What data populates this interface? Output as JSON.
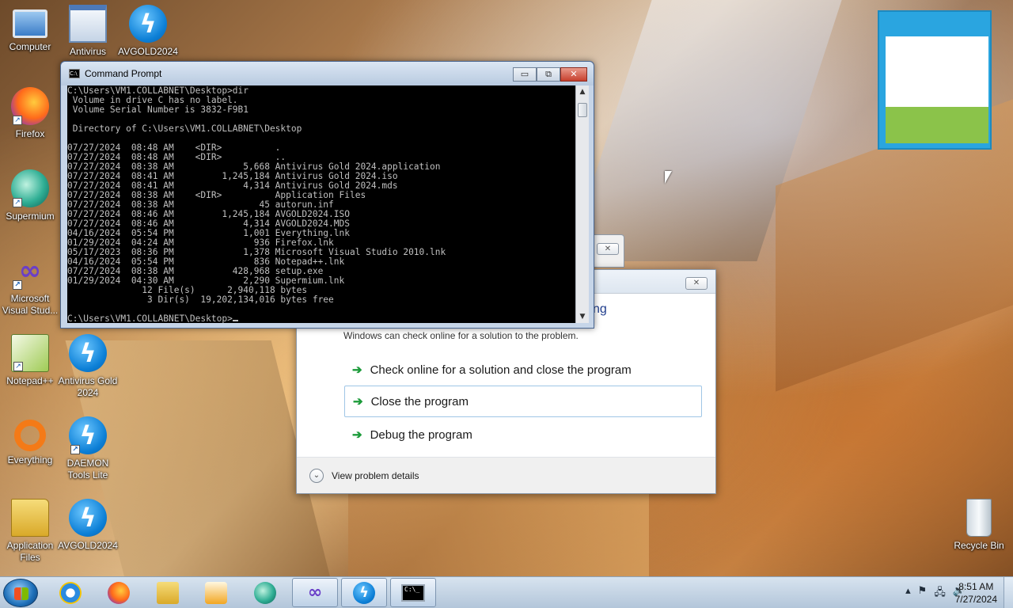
{
  "desktop": {
    "icons": [
      {
        "label": "Computer",
        "icon": "computer-icon"
      },
      {
        "label": "Antivirus",
        "icon": "antivirus-icon"
      },
      {
        "label": "AVGOLD2024",
        "icon": "daemon-bolt-icon"
      },
      {
        "label": "Firefox",
        "icon": "firefox-icon"
      },
      {
        "label": "Supermium",
        "icon": "supermium-icon"
      },
      {
        "label": "Microsoft Visual Stud...",
        "icon": "visual-studio-icon"
      },
      {
        "label": "Notepad++",
        "icon": "notepadpp-icon"
      },
      {
        "label": "Antivirus Gold 2024",
        "icon": "daemon-bolt-icon"
      },
      {
        "label": "Everything",
        "icon": "everything-icon"
      },
      {
        "label": "DAEMON Tools Lite",
        "icon": "daemon-bolt-icon"
      },
      {
        "label": "Application Files",
        "icon": "folder-icon"
      },
      {
        "label": "AVGOLD2024",
        "icon": "daemon-bolt-icon"
      },
      {
        "label": "Recycle Bin",
        "icon": "recycle-bin-icon"
      }
    ]
  },
  "cmd": {
    "title": "Command Prompt",
    "minimize": "▭",
    "restore": "⧉",
    "close": "✕",
    "lines": [
      "C:\\Users\\VM1.COLLABNET\\Desktop>dir",
      " Volume in drive C has no label.",
      " Volume Serial Number is 3832-F9B1",
      "",
      " Directory of C:\\Users\\VM1.COLLABNET\\Desktop",
      "",
      "07/27/2024  08:48 AM    <DIR>          .",
      "07/27/2024  08:48 AM    <DIR>          ..",
      "07/27/2024  08:38 AM             5,668 Antivirus Gold 2024.application",
      "07/27/2024  08:41 AM         1,245,184 Antivirus Gold 2024.iso",
      "07/27/2024  08:41 AM             4,314 Antivirus Gold 2024.mds",
      "07/27/2024  08:38 AM    <DIR>          Application Files",
      "07/27/2024  08:38 AM                45 autorun.inf",
      "07/27/2024  08:46 AM         1,245,184 AVGOLD2024.ISO",
      "07/27/2024  08:46 AM             4,314 AVGOLD2024.MDS",
      "04/16/2024  05:54 PM             1,001 Everything.lnk",
      "01/29/2024  04:24 AM               936 Firefox.lnk",
      "05/17/2023  08:36 PM             1,378 Microsoft Visual Studio 2010.lnk",
      "04/16/2024  05:54 PM               836 Notepad++.lnk",
      "07/27/2024  08:38 AM           428,968 setup.exe",
      "01/29/2024  04:30 AM             2,290 Supermium.lnk",
      "              12 File(s)      2,940,118 bytes",
      "               3 Dir(s)  19,202,134,016 bytes free",
      ""
    ],
    "prompt": "C:\\Users\\VM1.COLLABNET\\Desktop>"
  },
  "dialog": {
    "heading_fragment": "ng",
    "subtitle": "Windows can check online for a solution to the problem.",
    "options": [
      "Check online for a solution and close the program",
      "Close the program",
      "Debug the program"
    ],
    "details": "View problem details",
    "close": "✕"
  },
  "taskbar": {
    "clock_time": "8:51 AM",
    "clock_date": "7/27/2024",
    "items": [
      "internet-explorer-icon",
      "firefox-icon",
      "explorer-folder-icon",
      "media-player-icon",
      "supermium-icon",
      "visual-studio-icon",
      "daemon-bolt-icon",
      "command-prompt-icon"
    ]
  },
  "colors": {
    "accent": "#2aa5e0",
    "dialog_heading": "#1e3c8c",
    "arrow_green": "#1c9b3a"
  }
}
